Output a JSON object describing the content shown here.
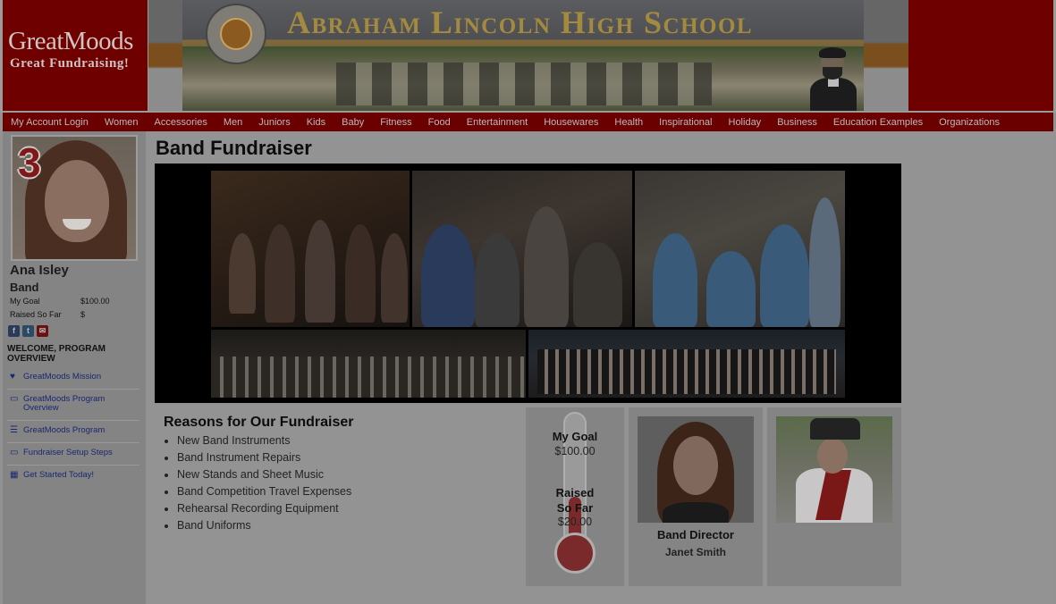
{
  "header": {
    "logo_main": "GreatMoods",
    "logo_sub": "Great Fundraising!",
    "banner_title": "Abraham Lincoln High School",
    "seal_text": "LINCOLN HIGH SCHOOL · LOS ANGELES, CALIFORNIA"
  },
  "nav": {
    "items": [
      "My Account Login",
      "Women",
      "Accessories",
      "Men",
      "Juniors",
      "Kids",
      "Baby",
      "Fitness",
      "Food",
      "Entertainment",
      "Housewares",
      "Health",
      "Inspirational",
      "Holiday",
      "Business",
      "Education Examples",
      "Organizations"
    ]
  },
  "sidebar": {
    "badge_number": "3",
    "student_name": "Ana Isley",
    "group": "Band",
    "goal_label": "My Goal",
    "goal_value": "$100.00",
    "raised_label": "Raised So Far",
    "raised_value": "$",
    "social_icons": [
      "facebook-icon",
      "twitter-icon",
      "email-icon"
    ],
    "welcome": "WELCOME, PROGRAM OVERVIEW",
    "menu": [
      {
        "icon": "heart-icon",
        "label": "GreatMoods Mission"
      },
      {
        "icon": "monitor-icon",
        "label": "GreatMoods Program Overview"
      },
      {
        "icon": "list-icon",
        "label": "GreatMoods Program"
      },
      {
        "icon": "monitor-icon",
        "label": "Fundraiser Setup Steps"
      },
      {
        "icon": "calendar-icon",
        "label": "Get Started Today!"
      }
    ]
  },
  "main": {
    "title": "Band Fundraiser",
    "reasons_title": "Reasons for Our Fundraiser",
    "reasons": [
      "New Band Instruments",
      "Band Instrument Repairs",
      "New Stands and Sheet Music",
      "Band Competition Travel Expenses",
      "Rehearsal Recording Equipment",
      "Band Uniforms"
    ],
    "thermometer": {
      "goal_label": "My Goal",
      "goal_value": "$100.00",
      "raised_label": "Raised So Far",
      "raised_value": "$20.00",
      "fill_fraction": 0.2
    },
    "director": {
      "title": "Band Director",
      "name": "Janet Smith"
    }
  },
  "colors": {
    "nav_bg": "#6a0000",
    "header_red": "#6e0000",
    "link_blue": "#1a2870",
    "page_bg": "#929292"
  }
}
